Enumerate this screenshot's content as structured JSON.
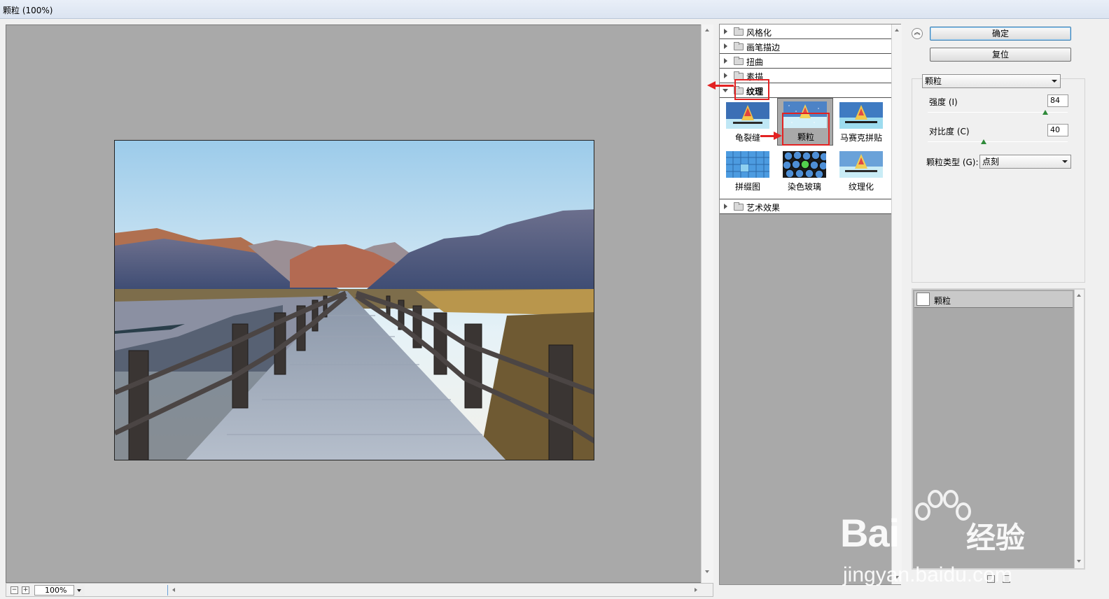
{
  "window": {
    "title": "颗粒 (100%)"
  },
  "preview": {
    "zoom": "100%",
    "zoom_minus": "−",
    "zoom_plus": "+"
  },
  "gallery": {
    "categories_top": [
      {
        "label": "风格化"
      },
      {
        "label": "画笔描边"
      },
      {
        "label": "扭曲"
      },
      {
        "label": "素描"
      }
    ],
    "open_category": {
      "label": "纹理"
    },
    "filters": [
      {
        "label": "龟裂缝"
      },
      {
        "label": "颗粒"
      },
      {
        "label": "马赛克拼贴"
      },
      {
        "label": "拼缀图"
      },
      {
        "label": "染色玻璃"
      },
      {
        "label": "纹理化"
      }
    ],
    "categories_bottom": [
      {
        "label": "艺术效果"
      }
    ],
    "selected_filter": "颗粒"
  },
  "buttons": {
    "ok": "确定",
    "reset": "复位"
  },
  "settings": {
    "filter_select": "颗粒",
    "intensity": {
      "label": "强度 (I)",
      "value": "84",
      "level": 84
    },
    "contrast": {
      "label": "对比度 (C)",
      "value": "40",
      "level": 40
    },
    "grain_type": {
      "label": "颗粒类型 (G):",
      "value": "点刻"
    }
  },
  "layers": {
    "items": [
      {
        "name": "颗粒"
      }
    ]
  },
  "watermark": {
    "brand": "Bai",
    "brand_cn": "经验",
    "url": "jingyan.baidu.com"
  },
  "colors": {
    "annotation_red": "#e32222",
    "preview_bg": "#a9a9a9",
    "slider_green": "#2f8a3a"
  }
}
